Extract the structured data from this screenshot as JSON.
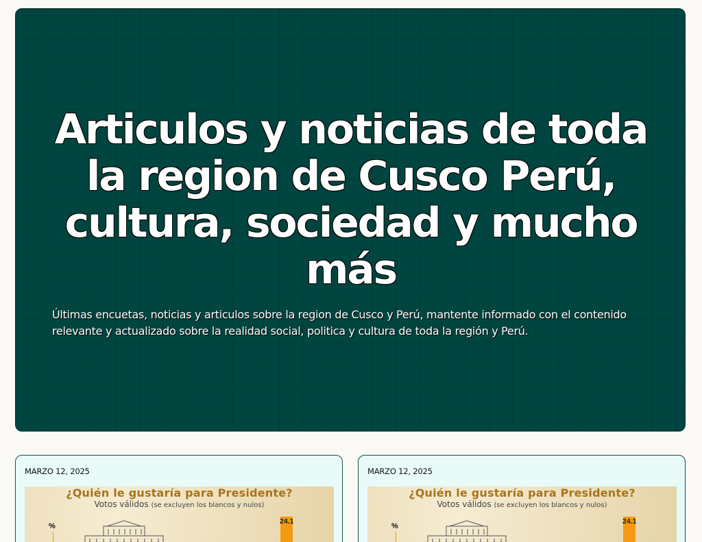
{
  "hero": {
    "title": "Articulos y noticias de toda la region de Cusco Perú, cultura, sociedad y mucho más",
    "description": "Últimas encuetas, noticias y articulos sobre la region de Cusco y Perú, mantente informado con el contenido relevante y actualizado sobre la realidad social, politica y cultura de toda la región y Perú.",
    "background_color": "#004540"
  },
  "cards": [
    {
      "date": "MARZO 12, 2025",
      "thumb_title": "¿Quién le gustaría para Presidente?",
      "thumb_subtitle": "Votos válidos",
      "thumb_subtitle_note": "(se excluyen los blancos y nulos)",
      "axis_label": "%",
      "bar_value": "24.1",
      "bar_color": "#f39a10"
    },
    {
      "date": "MARZO 12, 2025",
      "thumb_title": "¿Quién le gustaría para Presidente?",
      "thumb_subtitle": "Votos válidos",
      "thumb_subtitle_note": "(se excluyen los blancos y nulos)",
      "axis_label": "%",
      "bar_value": "24.1",
      "bar_color": "#f39a10"
    }
  ]
}
